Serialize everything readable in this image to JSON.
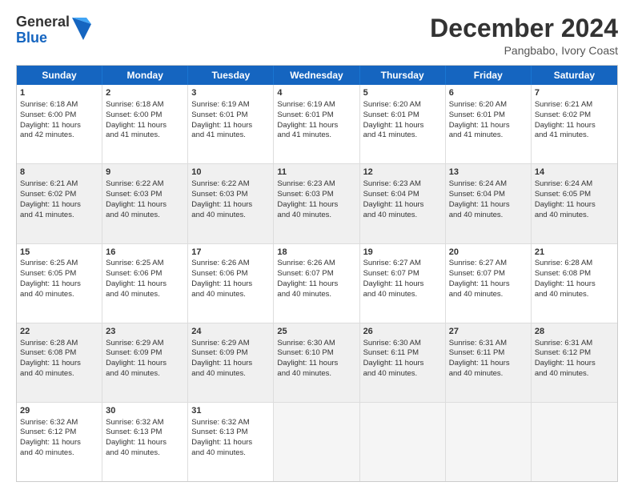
{
  "logo": {
    "general": "General",
    "blue": "Blue"
  },
  "header": {
    "month": "December 2024",
    "location": "Pangbabo, Ivory Coast"
  },
  "weekdays": [
    "Sunday",
    "Monday",
    "Tuesday",
    "Wednesday",
    "Thursday",
    "Friday",
    "Saturday"
  ],
  "weeks": [
    [
      {
        "day": "1",
        "lines": [
          "Sunrise: 6:18 AM",
          "Sunset: 6:00 PM",
          "Daylight: 11 hours",
          "and 42 minutes."
        ]
      },
      {
        "day": "2",
        "lines": [
          "Sunrise: 6:18 AM",
          "Sunset: 6:00 PM",
          "Daylight: 11 hours",
          "and 41 minutes."
        ]
      },
      {
        "day": "3",
        "lines": [
          "Sunrise: 6:19 AM",
          "Sunset: 6:01 PM",
          "Daylight: 11 hours",
          "and 41 minutes."
        ]
      },
      {
        "day": "4",
        "lines": [
          "Sunrise: 6:19 AM",
          "Sunset: 6:01 PM",
          "Daylight: 11 hours",
          "and 41 minutes."
        ]
      },
      {
        "day": "5",
        "lines": [
          "Sunrise: 6:20 AM",
          "Sunset: 6:01 PM",
          "Daylight: 11 hours",
          "and 41 minutes."
        ]
      },
      {
        "day": "6",
        "lines": [
          "Sunrise: 6:20 AM",
          "Sunset: 6:01 PM",
          "Daylight: 11 hours",
          "and 41 minutes."
        ]
      },
      {
        "day": "7",
        "lines": [
          "Sunrise: 6:21 AM",
          "Sunset: 6:02 PM",
          "Daylight: 11 hours",
          "and 41 minutes."
        ]
      }
    ],
    [
      {
        "day": "8",
        "lines": [
          "Sunrise: 6:21 AM",
          "Sunset: 6:02 PM",
          "Daylight: 11 hours",
          "and 41 minutes."
        ]
      },
      {
        "day": "9",
        "lines": [
          "Sunrise: 6:22 AM",
          "Sunset: 6:03 PM",
          "Daylight: 11 hours",
          "and 40 minutes."
        ]
      },
      {
        "day": "10",
        "lines": [
          "Sunrise: 6:22 AM",
          "Sunset: 6:03 PM",
          "Daylight: 11 hours",
          "and 40 minutes."
        ]
      },
      {
        "day": "11",
        "lines": [
          "Sunrise: 6:23 AM",
          "Sunset: 6:03 PM",
          "Daylight: 11 hours",
          "and 40 minutes."
        ]
      },
      {
        "day": "12",
        "lines": [
          "Sunrise: 6:23 AM",
          "Sunset: 6:04 PM",
          "Daylight: 11 hours",
          "and 40 minutes."
        ]
      },
      {
        "day": "13",
        "lines": [
          "Sunrise: 6:24 AM",
          "Sunset: 6:04 PM",
          "Daylight: 11 hours",
          "and 40 minutes."
        ]
      },
      {
        "day": "14",
        "lines": [
          "Sunrise: 6:24 AM",
          "Sunset: 6:05 PM",
          "Daylight: 11 hours",
          "and 40 minutes."
        ]
      }
    ],
    [
      {
        "day": "15",
        "lines": [
          "Sunrise: 6:25 AM",
          "Sunset: 6:05 PM",
          "Daylight: 11 hours",
          "and 40 minutes."
        ]
      },
      {
        "day": "16",
        "lines": [
          "Sunrise: 6:25 AM",
          "Sunset: 6:06 PM",
          "Daylight: 11 hours",
          "and 40 minutes."
        ]
      },
      {
        "day": "17",
        "lines": [
          "Sunrise: 6:26 AM",
          "Sunset: 6:06 PM",
          "Daylight: 11 hours",
          "and 40 minutes."
        ]
      },
      {
        "day": "18",
        "lines": [
          "Sunrise: 6:26 AM",
          "Sunset: 6:07 PM",
          "Daylight: 11 hours",
          "and 40 minutes."
        ]
      },
      {
        "day": "19",
        "lines": [
          "Sunrise: 6:27 AM",
          "Sunset: 6:07 PM",
          "Daylight: 11 hours",
          "and 40 minutes."
        ]
      },
      {
        "day": "20",
        "lines": [
          "Sunrise: 6:27 AM",
          "Sunset: 6:07 PM",
          "Daylight: 11 hours",
          "and 40 minutes."
        ]
      },
      {
        "day": "21",
        "lines": [
          "Sunrise: 6:28 AM",
          "Sunset: 6:08 PM",
          "Daylight: 11 hours",
          "and 40 minutes."
        ]
      }
    ],
    [
      {
        "day": "22",
        "lines": [
          "Sunrise: 6:28 AM",
          "Sunset: 6:08 PM",
          "Daylight: 11 hours",
          "and 40 minutes."
        ]
      },
      {
        "day": "23",
        "lines": [
          "Sunrise: 6:29 AM",
          "Sunset: 6:09 PM",
          "Daylight: 11 hours",
          "and 40 minutes."
        ]
      },
      {
        "day": "24",
        "lines": [
          "Sunrise: 6:29 AM",
          "Sunset: 6:09 PM",
          "Daylight: 11 hours",
          "and 40 minutes."
        ]
      },
      {
        "day": "25",
        "lines": [
          "Sunrise: 6:30 AM",
          "Sunset: 6:10 PM",
          "Daylight: 11 hours",
          "and 40 minutes."
        ]
      },
      {
        "day": "26",
        "lines": [
          "Sunrise: 6:30 AM",
          "Sunset: 6:11 PM",
          "Daylight: 11 hours",
          "and 40 minutes."
        ]
      },
      {
        "day": "27",
        "lines": [
          "Sunrise: 6:31 AM",
          "Sunset: 6:11 PM",
          "Daylight: 11 hours",
          "and 40 minutes."
        ]
      },
      {
        "day": "28",
        "lines": [
          "Sunrise: 6:31 AM",
          "Sunset: 6:12 PM",
          "Daylight: 11 hours",
          "and 40 minutes."
        ]
      }
    ],
    [
      {
        "day": "29",
        "lines": [
          "Sunrise: 6:32 AM",
          "Sunset: 6:12 PM",
          "Daylight: 11 hours",
          "and 40 minutes."
        ]
      },
      {
        "day": "30",
        "lines": [
          "Sunrise: 6:32 AM",
          "Sunset: 6:13 PM",
          "Daylight: 11 hours",
          "and 40 minutes."
        ]
      },
      {
        "day": "31",
        "lines": [
          "Sunrise: 6:32 AM",
          "Sunset: 6:13 PM",
          "Daylight: 11 hours",
          "and 40 minutes."
        ]
      },
      {
        "day": "",
        "lines": []
      },
      {
        "day": "",
        "lines": []
      },
      {
        "day": "",
        "lines": []
      },
      {
        "day": "",
        "lines": []
      }
    ]
  ]
}
